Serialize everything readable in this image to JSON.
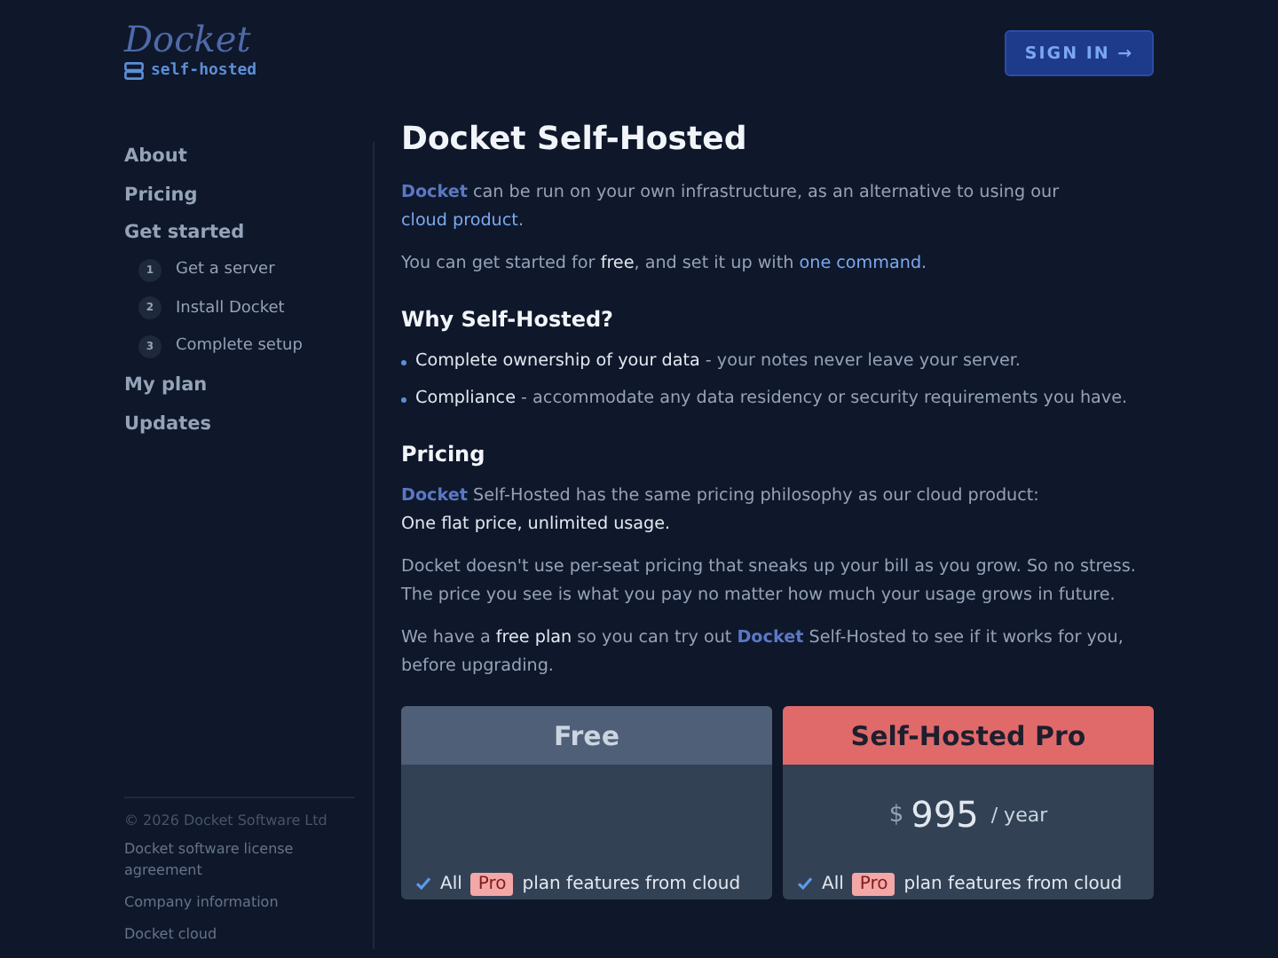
{
  "header": {
    "logo": "Docket",
    "edition": "self-hosted",
    "sign_in": "SIGN IN →"
  },
  "sidebar": {
    "items": [
      {
        "label": "About",
        "selected": false
      },
      {
        "label": "Pricing",
        "selected": false
      },
      {
        "label": "Get started",
        "selected": false,
        "children": [
          {
            "number": "1",
            "label": "Get a server"
          },
          {
            "number": "2",
            "label": "Install Docket"
          },
          {
            "number": "3",
            "label": "Complete setup"
          }
        ]
      },
      {
        "label": "My plan",
        "selected": false
      },
      {
        "label": "Updates",
        "selected": false
      }
    ],
    "footer": {
      "copyright": "© 2026 Docket Software Ltd",
      "links": [
        "Docket software license agreement",
        "Company information",
        "Docket cloud"
      ]
    }
  },
  "main": {
    "title": "Docket Self-Hosted",
    "blocks": [
      {
        "kind": "paragraph",
        "segments": [
          {
            "kind": "brand",
            "text": "Docket"
          },
          {
            "kind": "plain",
            "text": " can be run on your own infrastructure, as an alternative to using our "
          },
          {
            "kind": "link",
            "text": "cloud product"
          },
          {
            "kind": "plain",
            "text": "."
          }
        ]
      },
      {
        "kind": "paragraph",
        "segments": [
          {
            "kind": "plain",
            "text": "You can get started for "
          },
          {
            "kind": "strong",
            "text": "free"
          },
          {
            "kind": "plain",
            "text": ", and set it up with "
          },
          {
            "kind": "link",
            "text": "one command."
          }
        ]
      },
      {
        "kind": "heading",
        "text": "Why Self-Hosted?"
      },
      {
        "kind": "bullets",
        "items": [
          {
            "lead": "Complete ownership of your data",
            "rest": " - your notes never leave your server."
          },
          {
            "lead": "Compliance",
            "rest": " - accommodate any data residency or security requirements you have."
          }
        ]
      },
      {
        "kind": "heading",
        "text": "Pricing"
      },
      {
        "kind": "paragraph",
        "segments": [
          {
            "kind": "brand",
            "text": "Docket"
          },
          {
            "kind": "plain",
            "text": " Self-Hosted has the same pricing philosophy as our cloud product:"
          },
          {
            "kind": "break"
          },
          {
            "kind": "strong",
            "text": "One flat price, unlimited usage."
          }
        ]
      },
      {
        "kind": "paragraph",
        "segments": [
          {
            "kind": "plain",
            "text": "Docket doesn't use per-seat pricing that sneaks up your bill as you grow. So no stress. The price you see is what you pay no matter how much your usage grows in future."
          }
        ]
      },
      {
        "kind": "paragraph",
        "segments": [
          {
            "kind": "plain",
            "text": "We have a "
          },
          {
            "kind": "strong",
            "text": "free plan"
          },
          {
            "kind": "plain",
            "text": " so you can try out "
          },
          {
            "kind": "brand",
            "text": "Docket"
          },
          {
            "kind": "plain",
            "text": " Self-Hosted to see if it works for you, before upgrading."
          }
        ]
      }
    ],
    "plans": [
      {
        "name": "Free",
        "kind": "free",
        "features": [
          {
            "pre": "All",
            "tag": "Pro",
            "post": "plan features from cloud"
          }
        ]
      },
      {
        "name": "Self-Hosted Pro",
        "kind": "pro",
        "currency": "$",
        "price": "995",
        "period": "/ year",
        "features": [
          {
            "pre": "All",
            "tag": "Pro",
            "post": "plan features from cloud"
          }
        ]
      }
    ]
  }
}
